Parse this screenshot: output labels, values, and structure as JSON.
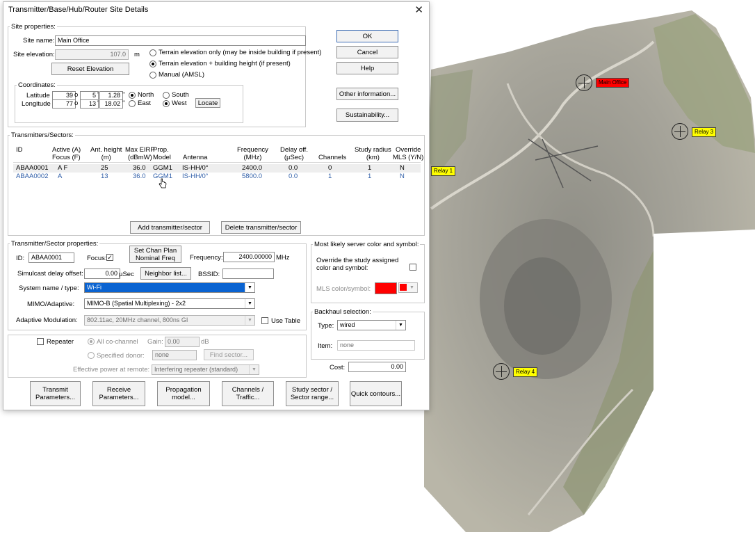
{
  "dialog": {
    "title": "Transmitter/Base/Hub/Router Site Details"
  },
  "site_properties": {
    "legend": "Site properties:",
    "site_name_label": "Site name:",
    "site_name": "Main Office",
    "site_elevation_label": "Site elevation:",
    "site_elevation": "107.0",
    "elevation_unit": "m",
    "elevation_options": [
      "Terrain elevation only (may be inside building if present)",
      "Terrain elevation + building height (if present)",
      "Manual (AMSL)"
    ],
    "elevation_selected_index": 1,
    "reset_button": "Reset Elevation"
  },
  "coordinates": {
    "legend": "Coordinates:",
    "latitude_label": "Latitude",
    "lat_deg": "39",
    "lat_min": "5",
    "lat_sec": "1.28",
    "north": "North",
    "south": "South",
    "longitude_label": "Longitude",
    "lon_deg": "77",
    "lon_min": "13",
    "lon_sec": "18.02",
    "east": "East",
    "west": "West",
    "locate": "Locate",
    "deg_symbol": "o",
    "min_symbol": "'",
    "sec_symbol": "''"
  },
  "side_buttons": {
    "ok": "OK",
    "cancel": "Cancel",
    "help": "Help",
    "other_info": "Other information...",
    "sustainability": "Sustainability..."
  },
  "transmitters": {
    "legend": "Transmitters/Sectors:",
    "columns": [
      "ID",
      "Active (A)\nFocus (F)",
      "Ant. height\n(m)",
      "Max EIRP\n(dBmW)",
      "Prop.\nModel",
      "Antenna",
      "Frequency\n(MHz)",
      "Delay off.\n(µSec)",
      "Channels",
      "Study radius\n(km)",
      "Override\nMLS (Y/N)"
    ],
    "rows": [
      [
        "ABAA0001",
        "A F",
        "25",
        "36.0",
        "GGM1",
        "IS-HH/0°",
        "2400.0",
        "0.0",
        "0",
        "1",
        "N"
      ],
      [
        "ABAA0002",
        "A",
        "13",
        "36.0",
        "GGM1",
        "IS-HH/0°",
        "5800.0",
        "0.0",
        "1",
        "1",
        "N"
      ]
    ],
    "add_button": "Add transmitter/sector",
    "delete_button": "Delete transmitter/sector"
  },
  "sector_properties": {
    "legend": "Transmitter/Sector properties:",
    "id_label": "ID:",
    "id_value": "ABAA0001",
    "focus_label": "Focus:",
    "focus_checked": true,
    "set_chan_plan": "Set Chan Plan\nNominal Freq",
    "frequency_label": "Frequency:",
    "frequency_value": "2400.00000",
    "frequency_unit": "MHz",
    "simulcast_label": "Simulcast delay offset:",
    "simulcast_value": "0.00",
    "simulcast_unit": "µSec",
    "neighbor_button": "Neighbor list...",
    "bssid_label": "BSSID:",
    "bssid_value": "",
    "system_label": "System name / type:",
    "system_value": "Wi-Fi",
    "mimo_label": "MIMO/Adaptive:",
    "mimo_value": "MIMO-B (Spatial Multiplexing) - 2x2",
    "adaptive_label": "Adaptive Modulation:",
    "adaptive_value": "802.11ac, 20MHz channel, 800ns GI",
    "use_table_label": "Use Table"
  },
  "repeater": {
    "repeater_label": "Repeater",
    "all_cochannel": "All co-channel",
    "gain_label": "Gain:",
    "gain_value": "0.00",
    "gain_unit": "dB",
    "specified_donor": "Specified donor:",
    "donor_value": "none",
    "find_sector": "Find sector...",
    "effective_power_label": "Effective power at remote:",
    "effective_power_value": "Interfering repeater (standard)"
  },
  "mls": {
    "legend": "Most likely server color and symbol:",
    "override_label": "Override the study assigned\ncolor and symbol:",
    "mls_label": "MLS color/symbol:",
    "color": "#ff0000"
  },
  "backhaul": {
    "legend": "Backhaul selection:",
    "type_label": "Type:",
    "type_value": "wired",
    "item_label": "Item:",
    "item_value": "none",
    "cost_label": "Cost:",
    "cost_value": "0.00"
  },
  "bottom_buttons": [
    "Transmit\nParameters...",
    "Receive\nParameters...",
    "Propagation\nmodel...",
    "Channels /\nTraffic...",
    "Study sector /\nSector range...",
    "Quick contours..."
  ],
  "map": {
    "labels": {
      "main_office": "Main Office",
      "relay_1": "Relay 1",
      "relay_3": "Relay 3",
      "relay_4": "Relay 4"
    },
    "colors": {
      "main_office_label_bg": "#ff0000",
      "relay_label_bg": "#ffff00"
    }
  }
}
